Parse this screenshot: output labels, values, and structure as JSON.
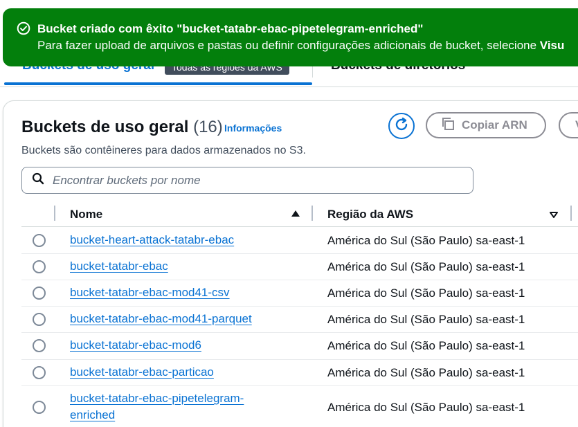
{
  "flash": {
    "title": "Bucket criado com êxito \"bucket-tatabr-ebac-pipetelegram-enriched\"",
    "message": "Para fazer upload de arquivos e pastas ou definir configurações adicionais de bucket, selecione ",
    "message_bold": "Visu",
    "icon": "check-circle-icon",
    "color": "#037f0c"
  },
  "tabs": {
    "general": "Buckets de uso geral",
    "badge": "Todas as regiões da AWS",
    "directory": "Buckets de diretórios"
  },
  "header": {
    "title": "Buckets de uso geral",
    "count": "(16)",
    "info": "Informações",
    "description": "Buckets são contêineres para dados armazenados no S3."
  },
  "actions": {
    "refresh_icon": "refresh-icon",
    "copy_arn": "Copiar ARN",
    "more": "V"
  },
  "search": {
    "placeholder": "Encontrar buckets por nome"
  },
  "table": {
    "columns": {
      "name": "Nome",
      "region": "Região da AWS"
    },
    "rows": [
      {
        "name": "bucket-heart-attack-tatabr-ebac",
        "region": "América do Sul (São Paulo) sa-east-1"
      },
      {
        "name": "bucket-tatabr-ebac",
        "region": "América do Sul (São Paulo) sa-east-1"
      },
      {
        "name": "bucket-tatabr-ebac-mod41-csv",
        "region": "América do Sul (São Paulo) sa-east-1"
      },
      {
        "name": "bucket-tatabr-ebac-mod41-parquet",
        "region": "América do Sul (São Paulo) sa-east-1"
      },
      {
        "name": "bucket-tatabr-ebac-mod6",
        "region": "América do Sul (São Paulo) sa-east-1"
      },
      {
        "name": "bucket-tatabr-ebac-particao",
        "region": "América do Sul (São Paulo) sa-east-1"
      },
      {
        "name": "bucket-tatabr-ebac-pipetelegram-enriched",
        "region": "América do Sul (São Paulo) sa-east-1"
      }
    ]
  },
  "colors": {
    "link": "#0972d3",
    "success": "#037f0c"
  }
}
